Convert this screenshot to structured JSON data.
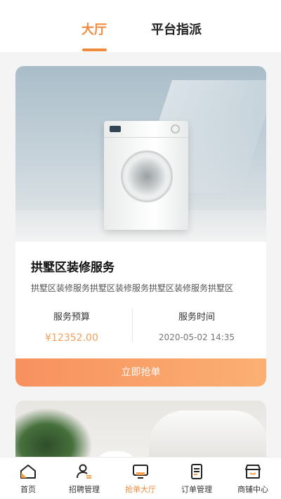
{
  "tabs": [
    {
      "label": "大厅",
      "active": true
    },
    {
      "label": "平台指派",
      "active": false
    }
  ],
  "accent_color": "#f08a3c",
  "order_card": {
    "image_icon": "washing-machine",
    "title": "拱墅区装修服务",
    "description": "拱墅区装修服务拱墅区装修服务拱墅区装修服务拱墅区",
    "budget_label": "服务预算",
    "budget_value": "¥12352.00",
    "time_label": "服务时间",
    "time_value": "2020-05-02 14:35",
    "action_label": "立即抢单"
  },
  "bottom_nav": [
    {
      "label": "首页",
      "icon": "home-icon",
      "active": false
    },
    {
      "label": "招聘管理",
      "icon": "user-list-icon",
      "active": false
    },
    {
      "label": "抢单大厅",
      "icon": "monitor-icon",
      "active": true
    },
    {
      "label": "订单管理",
      "icon": "document-icon",
      "active": false
    },
    {
      "label": "商铺中心",
      "icon": "shop-icon",
      "active": false
    }
  ]
}
